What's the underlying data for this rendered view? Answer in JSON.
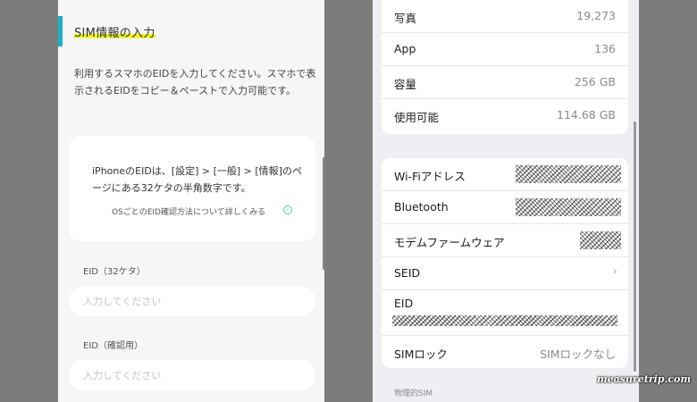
{
  "left_form": {
    "section_title": "SIM情報の入力",
    "description": "利用するスマホのEIDを入力してください。スマホで表示されるEIDをコピー＆ペーストで入力可能です。",
    "info_card": {
      "text": "iPhoneのEIDは、[設定] > [一般] > [情報]のページにある32ケタの半角数字です。",
      "link_text": "OSごとのEID確認方法について詳しくみる",
      "link_icon": "info-circle-icon"
    },
    "fields": [
      {
        "label": "EID（32ケタ）",
        "placeholder": "入力してください"
      },
      {
        "label": "EID（確認用）",
        "placeholder": "入力してください"
      }
    ],
    "accent_color": "#19b2c4",
    "highlight_color": "#eef400"
  },
  "settings": {
    "group1": [
      {
        "label": "写真",
        "value": "19,273"
      },
      {
        "label": "App",
        "value": "136"
      },
      {
        "label": "容量",
        "value": "256 GB"
      },
      {
        "label": "使用可能",
        "value": "114.68 GB"
      }
    ],
    "group2": {
      "wifi_label": "Wi-Fiアドレス",
      "bluetooth_label": "Bluetooth",
      "modem_label": "モデムファームウェア",
      "seid_label": "SEID",
      "eid_label": "EID",
      "simlock_label": "SIMロック",
      "simlock_value": "SIMロックなし"
    },
    "section_footer": "物理的SIM"
  },
  "watermark": "measuretrip.com"
}
